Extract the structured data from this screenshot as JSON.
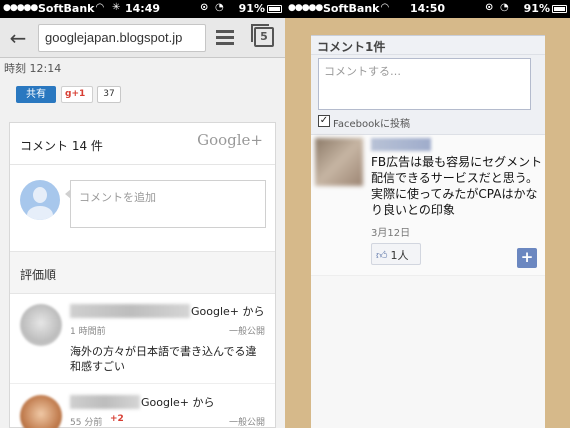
{
  "left": {
    "status": {
      "carrier": "SoftBank",
      "time": "14:49",
      "battery": "91%"
    },
    "browser": {
      "url": "googlejapan.blogspot.jp",
      "tab_count": "5"
    },
    "post": {
      "timestamp": "時刻 12:14",
      "share_label": "共有",
      "gplus_label": "+1",
      "gplus_count": "37"
    },
    "comments": {
      "title": "コメント 14 件",
      "google_plus": "Google+",
      "add_placeholder": "コメントを追加",
      "sort_label": "評価順",
      "items": [
        {
          "source": "Google+ から",
          "time": "1 時間前",
          "plus": "",
          "visibility": "一般公開",
          "text": "海外の方々が日本語で書き込んでる違和感すごい"
        },
        {
          "source": "Google+ から",
          "time": "55 分前",
          "plus": "+2",
          "visibility": "一般公開",
          "text": ""
        }
      ]
    }
  },
  "right": {
    "status": {
      "carrier": "SoftBank",
      "time": "14:50",
      "battery": "91%"
    },
    "fb": {
      "title": "コメント1件",
      "placeholder": "コメントする…",
      "checkbox_label": "Facebookに投稿",
      "comment_text": "FB広告は最も容易にセグメント配信できるサービスだと思う。実際に使ってみたがCPAはかなり良いとの印象",
      "comment_date": "3月12日",
      "likes": "1人"
    }
  },
  "colors": {
    "facebook_blue": "#6b87c0",
    "share_blue": "#2a78c0",
    "gplus_red": "#d73d32"
  }
}
